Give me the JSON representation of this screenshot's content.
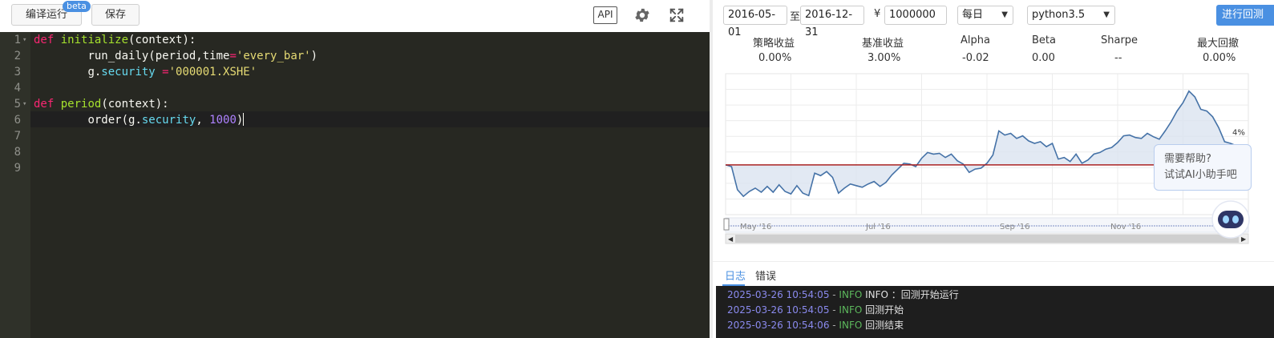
{
  "toolbar": {
    "compile_label": "编译运行",
    "beta_label": "beta",
    "save_label": "保存",
    "api_label": "API"
  },
  "editor": {
    "lines": [
      {
        "num": "1",
        "fold": "▾"
      },
      {
        "num": "2"
      },
      {
        "num": "3"
      },
      {
        "num": "4"
      },
      {
        "num": "5",
        "fold": "▾"
      },
      {
        "num": "6"
      },
      {
        "num": "7"
      },
      {
        "num": "8"
      },
      {
        "num": "9"
      }
    ],
    "code": {
      "l1": {
        "kw": "def",
        "fn": "initialize",
        "rest": "(context):"
      },
      "l2": {
        "indent": "        ",
        "a": "run_daily(period,time",
        "op": "=",
        "str": "'every_bar'",
        "close": ")"
      },
      "l3": {
        "indent": "        ",
        "obj": "g.",
        "attr": "security",
        "op": " =",
        "str": "'000001.XSHE'"
      },
      "l5": {
        "kw": "def",
        "fn": "period",
        "rest": "(context):"
      },
      "l6": {
        "indent": "        ",
        "a": "order(g.",
        "attr": "security",
        "sep": ", ",
        "num": "1000",
        "close": ")"
      }
    }
  },
  "backtest": {
    "start_date": "2016-05-01",
    "to_label": "至",
    "end_date": "2016-12-31",
    "yen_label": "¥",
    "capital": "1000000",
    "frequency": "每日",
    "python_version": "python3.5",
    "run_label": "进行回测"
  },
  "metrics": [
    {
      "label": "策略收益",
      "value": "0.00%"
    },
    {
      "label": "基准收益",
      "value": "3.00%"
    },
    {
      "label": "Alpha",
      "value": "-0.02"
    },
    {
      "label": "Beta",
      "value": "0.00"
    },
    {
      "label": "Sharpe",
      "value": "--"
    },
    {
      "label": "最大回撤",
      "value": "0.00%"
    }
  ],
  "chart_data": {
    "type": "line",
    "x_labels": [
      "May '16",
      "Jul '16",
      "Sep '16",
      "Nov '16"
    ],
    "y_label_visible": "4%",
    "ylim": [
      -6,
      11
    ],
    "series": [
      {
        "color": "#4572a7",
        "fill": "#dbe4f0",
        "values": [
          0,
          -0.2,
          -3,
          -3.8,
          -3.2,
          -2.8,
          -3.3,
          -2.6,
          -3.3,
          -2.4,
          -3.2,
          -3.5,
          -2.5,
          -3.4,
          -3.7,
          -1,
          -1.3,
          -0.8,
          -1.5,
          -3.4,
          -2.8,
          -2.3,
          -2.5,
          -2.7,
          -2.3,
          -2,
          -2.6,
          -2.1,
          -1.2,
          -0.5,
          0.2,
          0.1,
          -0.2,
          0.8,
          1.5,
          1.3,
          1.4,
          0.9,
          1.3,
          0.5,
          0.1,
          -0.9,
          -0.5,
          -0.4,
          0.2,
          1.2,
          4.1,
          3.6,
          3.8,
          3.2,
          3.5,
          2.9,
          2.6,
          2.8,
          2.2,
          2.6,
          0.7,
          0.9,
          0.4,
          1.3,
          0.2,
          0.6,
          1.3,
          1.5,
          1.9,
          2.1,
          2.7,
          3.5,
          3.6,
          3.3,
          3.2,
          3.8,
          3.4,
          3.1,
          4.1,
          5.2,
          6.5,
          7.5,
          8.9,
          8.2,
          6.7,
          6.5,
          5.8,
          4.5,
          2.8,
          2.6,
          2.3,
          2.1,
          2.3
        ]
      },
      {
        "color": "#aa2222",
        "values": [
          0,
          0
        ]
      }
    ]
  },
  "help": {
    "line1": "需要帮助?",
    "line2": "试试AI小助手吧"
  },
  "log": {
    "tabs": [
      "日志",
      "错误"
    ],
    "entries": [
      {
        "time": "2025-03-26 10:54:05",
        "level": "INFO",
        "message": "INFO ：回测开始运行"
      },
      {
        "time": "2025-03-26 10:54:05",
        "level": "INFO",
        "message": "回测开始"
      },
      {
        "time": "2025-03-26 10:54:06",
        "level": "INFO",
        "message": "回测结束"
      }
    ]
  }
}
